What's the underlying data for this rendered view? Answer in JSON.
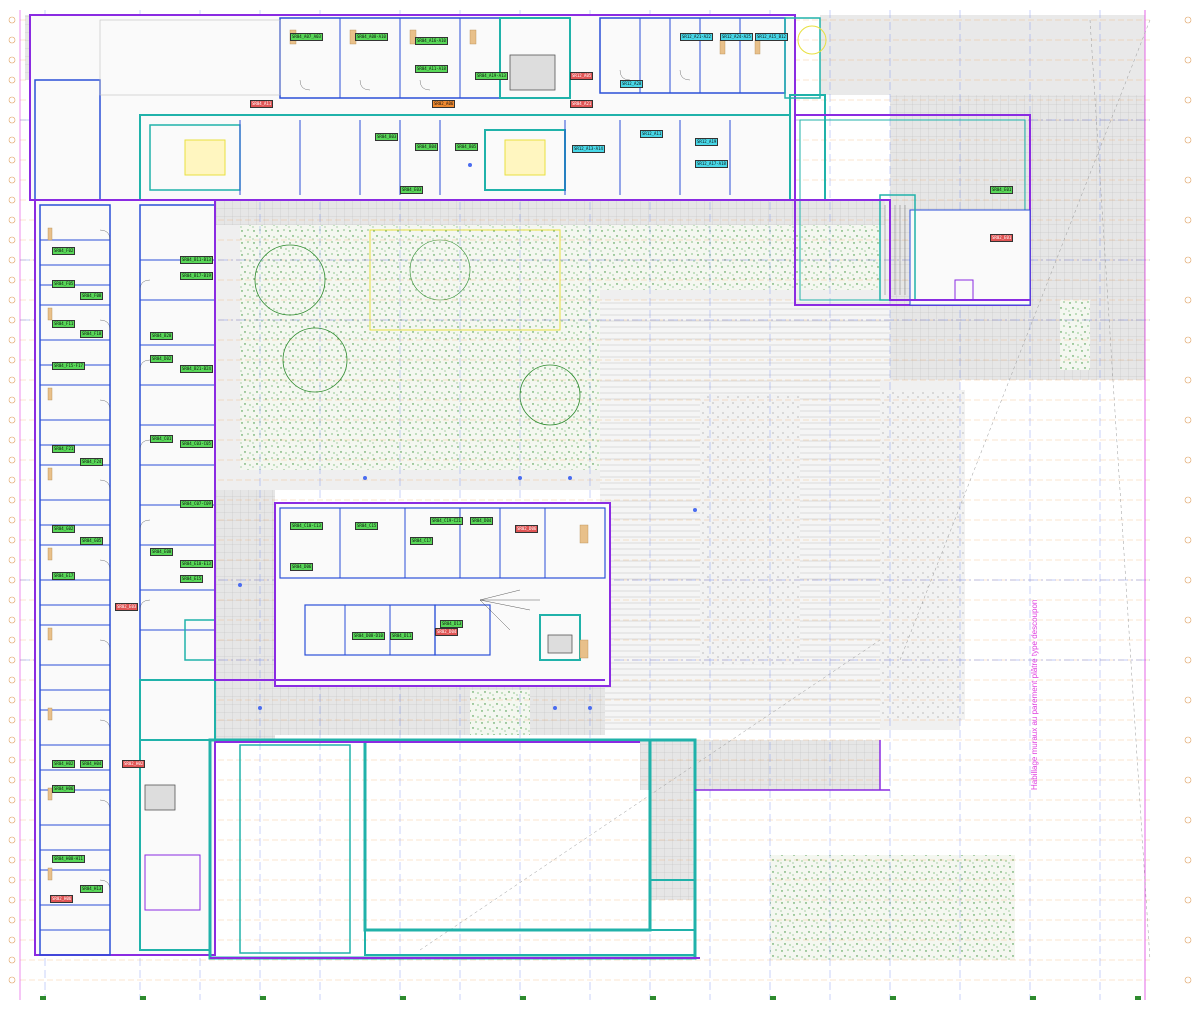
{
  "colors": {
    "wall_outer": "#8a2be2",
    "wall_inner": "#20b2aa",
    "wall_blue": "#2b4fd8",
    "grid_orange": "#f0a050",
    "grid_blue": "#4a6cf0",
    "grid_magenta": "#e040e0",
    "pavement_gray": "#d8d8d8",
    "vegetation": "#2e8b2e",
    "yellow_outline": "#e8e040",
    "tag_green": "#58d858",
    "tag_red": "#e05555",
    "tag_cyan": "#48d8e8",
    "tag_orange": "#f08a30"
  },
  "labels": {
    "vertical_note": "Habillage muraux au parement plâtre type descoupon"
  },
  "tags": [
    {
      "text": "SR04_A07_A03",
      "color": "green"
    },
    {
      "text": "SR04_A08-A10",
      "color": "green"
    },
    {
      "text": "SR04_A16-A10",
      "color": "green"
    },
    {
      "text": "SR04_A11-A18",
      "color": "green"
    },
    {
      "text": "SR04_A19-A13",
      "color": "green"
    },
    {
      "text": "SR12_A05",
      "color": "red"
    },
    {
      "text": "SR12_A21-A22",
      "color": "cyan"
    },
    {
      "text": "SR12_A24-A25",
      "color": "cyan"
    },
    {
      "text": "SR12_A28",
      "color": "cyan"
    },
    {
      "text": "SR12_A15_B12",
      "color": "cyan"
    },
    {
      "text": "SR04_A11",
      "color": "red"
    },
    {
      "text": "SR04_A21",
      "color": "red"
    },
    {
      "text": "SR02_A06",
      "color": "orange"
    },
    {
      "text": "SR04_B03",
      "color": "green"
    },
    {
      "text": "SR04_B04",
      "color": "green"
    },
    {
      "text": "SR04_B05",
      "color": "green"
    },
    {
      "text": "SR12_A13-A14",
      "color": "cyan"
    },
    {
      "text": "SR12_A11",
      "color": "cyan"
    },
    {
      "text": "SR12_A17-A18",
      "color": "cyan"
    },
    {
      "text": "SR12_A19",
      "color": "cyan"
    },
    {
      "text": "SR04_E01",
      "color": "green"
    },
    {
      "text": "SR02_E01",
      "color": "red"
    },
    {
      "text": "SR04_E03",
      "color": "green"
    },
    {
      "text": "SR04_B11-B13",
      "color": "green"
    },
    {
      "text": "SR04_B17-B19",
      "color": "green"
    },
    {
      "text": "SR04_B20",
      "color": "green"
    },
    {
      "text": "SR04_B21-B24",
      "color": "green"
    },
    {
      "text": "SR04_D02",
      "color": "green"
    },
    {
      "text": "SR04_C01",
      "color": "green"
    },
    {
      "text": "SR04_C03-C05",
      "color": "green"
    },
    {
      "text": "SR04_C07-C09",
      "color": "green"
    },
    {
      "text": "SR04_F02",
      "color": "green"
    },
    {
      "text": "SR04_F05",
      "color": "green"
    },
    {
      "text": "SR04_F08",
      "color": "green"
    },
    {
      "text": "SR04_F11",
      "color": "green"
    },
    {
      "text": "SR04_F15-F17",
      "color": "green"
    },
    {
      "text": "SR04_F18",
      "color": "green"
    },
    {
      "text": "SR04_F21",
      "color": "green"
    },
    {
      "text": "SR04_F24",
      "color": "green"
    },
    {
      "text": "SR04_G02",
      "color": "green"
    },
    {
      "text": "SR04_G05",
      "color": "green"
    },
    {
      "text": "SR04_C10-C13",
      "color": "green"
    },
    {
      "text": "SR04_C15",
      "color": "green"
    },
    {
      "text": "SR04_C17",
      "color": "green"
    },
    {
      "text": "SR04_C19-C21",
      "color": "green"
    },
    {
      "text": "SR04_D04",
      "color": "green"
    },
    {
      "text": "SR04_D06",
      "color": "green"
    },
    {
      "text": "SR04_D08-D10",
      "color": "green"
    },
    {
      "text": "SR04_D11",
      "color": "green"
    },
    {
      "text": "SR04_D13",
      "color": "green"
    },
    {
      "text": "SR02_D04",
      "color": "red"
    },
    {
      "text": "SR02_D06",
      "color": "red"
    },
    {
      "text": "SR04_E08",
      "color": "green"
    },
    {
      "text": "SR04_E10-E13",
      "color": "green"
    },
    {
      "text": "SR04_E15",
      "color": "green"
    },
    {
      "text": "SR04_E17",
      "color": "green"
    },
    {
      "text": "SR02_E03",
      "color": "red"
    },
    {
      "text": "SR04_H02",
      "color": "green"
    },
    {
      "text": "SR04_H04",
      "color": "green"
    },
    {
      "text": "SR04_H06",
      "color": "green"
    },
    {
      "text": "SR02_H02",
      "color": "red"
    },
    {
      "text": "SR04_H08-H11",
      "color": "green"
    },
    {
      "text": "SR04_H13",
      "color": "green"
    },
    {
      "text": "SR02_H06",
      "color": "red"
    }
  ]
}
